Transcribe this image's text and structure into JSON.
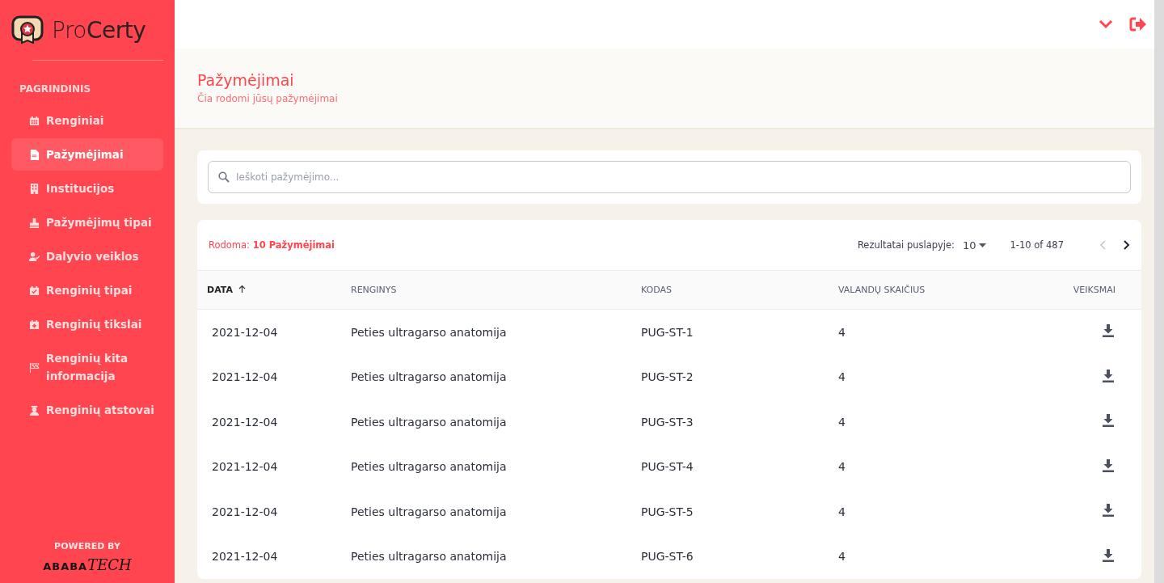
{
  "sidebar": {
    "logo": "Pro**Certy**",
    "section": "PAGRINDINIS",
    "items": [
      {
        "label": "Renginiai",
        "kind": "calendar",
        "selected": false
      },
      {
        "label": "Pažymėjimai",
        "kind": "document",
        "selected": true
      },
      {
        "label": "Institucijos",
        "kind": "building",
        "selected": false
      },
      {
        "label": "Pažymėjimų tipai",
        "kind": "stamp",
        "selected": false
      },
      {
        "label": "Dalyvio veiklos",
        "kind": "user",
        "selected": false
      },
      {
        "label": "Renginių tipai",
        "kind": "check",
        "selected": false
      },
      {
        "label": "Renginių tikslai",
        "kind": "plus",
        "selected": false
      },
      {
        "label": "Renginių kita informacija",
        "kind": "flag",
        "selected": false
      },
      {
        "label": "Renginių atstovai",
        "kind": "person",
        "selected": false
      }
    ],
    "powered_by": "POWERED BY",
    "brand": {
      "text": "ABABA",
      "script": "TECH"
    }
  },
  "page": {
    "title": "Pažymėjimai",
    "subtitle": "Čia rodomi jūsų pažymėjimai"
  },
  "search": {
    "placeholder": "Ieškoti pažymėjimo..."
  },
  "table": {
    "summary": "Rodoma: **10 Pažymėjimai**",
    "per_page_label": "Rezultatai puslapyje:",
    "per_page": "10",
    "range": "1-10 of 487",
    "prev_disabled": true,
    "next_disabled": false,
    "columns": [
      {
        "label": "DATA",
        "sorted": true
      },
      {
        "label": "RENGINYS",
        "sorted": false
      },
      {
        "label": "KODAS",
        "sorted": false
      },
      {
        "label": "VALANDŲ SKAIČIUS",
        "sorted": false
      },
      {
        "label": "VEIKSMAI",
        "sorted": false
      }
    ],
    "rows": [
      {
        "date": "2021-12-04",
        "event": "Peties ultragarso anatomija",
        "code": "PUG-ST-1",
        "hours": "4"
      },
      {
        "date": "2021-12-04",
        "event": "Peties ultragarso anatomija",
        "code": "PUG-ST-2",
        "hours": "4"
      },
      {
        "date": "2021-12-04",
        "event": "Peties ultragarso anatomija",
        "code": "PUG-ST-3",
        "hours": "4"
      },
      {
        "date": "2021-12-04",
        "event": "Peties ultragarso anatomija",
        "code": "PUG-ST-4",
        "hours": "4"
      },
      {
        "date": "2021-12-04",
        "event": "Peties ultragarso anatomija",
        "code": "PUG-ST-5",
        "hours": "4"
      },
      {
        "date": "2021-12-04",
        "event": "Peties ultragarso anatomija",
        "code": "PUG-ST-6",
        "hours": "4"
      }
    ]
  }
}
